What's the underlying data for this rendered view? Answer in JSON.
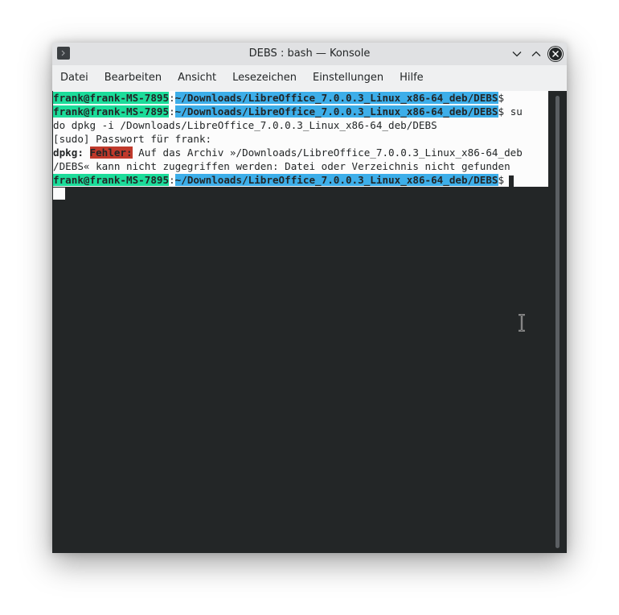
{
  "window": {
    "title": "DEBS : bash — Konsole"
  },
  "titlebar_buttons": {
    "minimize_icon": "chevron-down-icon",
    "maximize_icon": "chevron-up-icon",
    "close_icon": "close-icon"
  },
  "menubar": {
    "items": [
      {
        "label": "Datei"
      },
      {
        "label": "Bearbeiten"
      },
      {
        "label": "Ansicht"
      },
      {
        "label": "Lesezeichen"
      },
      {
        "label": "Einstellungen"
      },
      {
        "label": "Hilfe"
      }
    ]
  },
  "terminal": {
    "user_host": "frank@frank-MS-7895",
    "colon": ":",
    "cwd": "~/Downloads/LibreOffice_7.0.0.3_Linux_x86-64_deb/DEBS",
    "prompt_symbol": "$",
    "cmd_part1": " su",
    "cmd_part2": "do dpkg -i /Downloads/LibreOffice_7.0.0.3_Linux_x86-64_deb/DEBS",
    "sudo_prompt": "[sudo] Passwort für frank:",
    "dpkg_label": "dpkg:",
    "error_label": "Fehler:",
    "error_msg1": " Auf das Archiv »/Downloads/LibreOffice_7.0.0.3_Linux_x86-64_deb",
    "error_msg2": "/DEBS« kann nicht zugegriffen werden: Datei oder Verzeichnis nicht gefunden"
  },
  "colors": {
    "terminal_bg": "#232627",
    "line_bg": "#fcfcfc",
    "host_bg": "#1cdc9a",
    "path_bg": "#3daee9",
    "error_bg": "#c0392b"
  }
}
